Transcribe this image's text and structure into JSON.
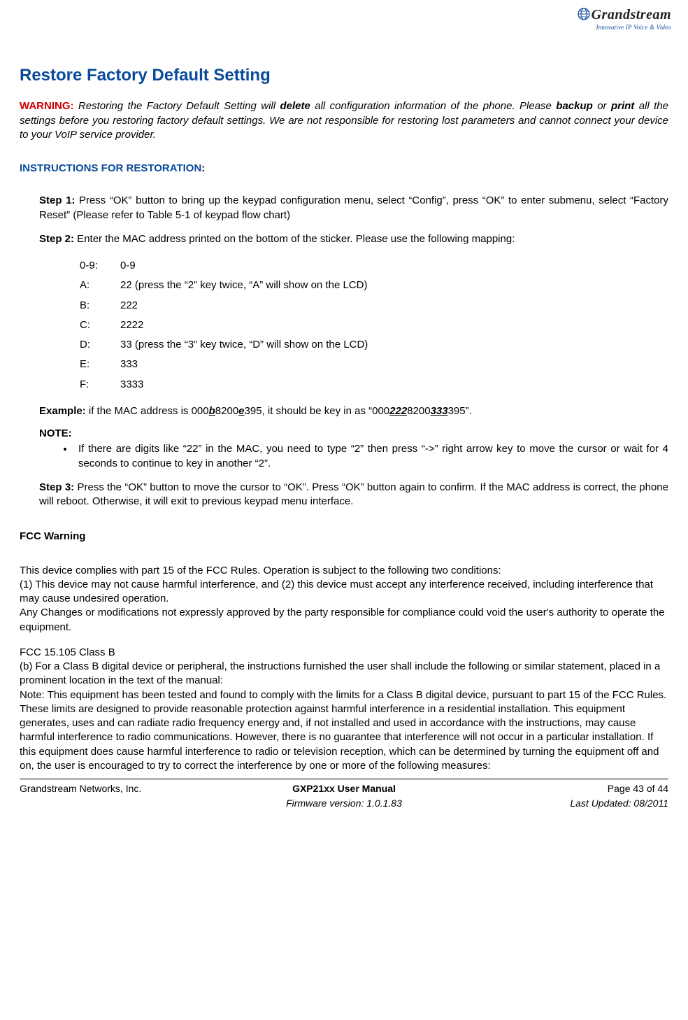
{
  "logo": {
    "brand": "Grandstream",
    "tagline": "Innovative IP Voice & Video"
  },
  "title": "Restore Factory Default Setting",
  "warning": {
    "label": "WARNING:",
    "pre": " Restoring the Factory Default Setting will ",
    "bold1": "delete",
    "mid": " all configuration information of the phone. Please ",
    "bold2": "backup",
    "mid2": " or ",
    "bold3": "print",
    "post": " all the settings before you restoring factory default settings. We are not responsible for restoring lost parameters and cannot connect your device to your VoIP service provider."
  },
  "instructions_header": "INSTRUCTIONS FOR RESTORATION",
  "step1": {
    "label": "Step 1:",
    "text": " Press “OK” button to bring up the keypad configuration menu, select “Config”, press “OK” to enter submenu, select “Factory Reset” (Please refer to Table 5-1 of keypad flow chart)"
  },
  "step2": {
    "label": "Step 2:",
    "text": " Enter the MAC address printed on the bottom of the sticker. Please use the following mapping:"
  },
  "mapping": [
    {
      "k": "0-9:",
      "v": "0-9"
    },
    {
      "k": "A:",
      "v": "22  (press the “2” key twice, “A” will show on the LCD)"
    },
    {
      "k": "B:",
      "v": "222"
    },
    {
      "k": "C:",
      "v": "2222"
    },
    {
      "k": "D:",
      "v": "33  (press the “3” key twice, “D” will show on the LCD)"
    },
    {
      "k": "E:",
      "v": "333"
    },
    {
      "k": "F:",
      "v": "3333"
    }
  ],
  "example": {
    "label": "Example:",
    "pre": "  if the MAC address is 000",
    "u1": "b",
    "mid1": "8200",
    "u2": "e",
    "mid2": "395, it should be key in as “000",
    "u3": "222",
    "mid3": "8200",
    "u4": "333",
    "post": "395”."
  },
  "note": {
    "label": "NOTE:",
    "item": "If there are digits like “22” in the MAC, you need to type “2” then press “->” right arrow key to move the cursor or wait for 4 seconds to continue to key in another “2”."
  },
  "step3": {
    "label": "Step 3:",
    "text": "  Press the “OK” button to move the cursor to “OK”. Press “OK” button again to confirm. If the MAC address is correct, the phone will reboot. Otherwise, it will exit to previous keypad menu interface."
  },
  "fcc": {
    "heading": "FCC  Warning",
    "p1": "This device complies with part 15 of the FCC Rules. Operation is subject to the following two conditions:",
    "p2": " (1) This device may not cause harmful interference, and (2) this device must accept any interference received, including  interference that may cause undesired operation.",
    "p3": "Any Changes or modifications not expressly approved by the party responsible for compliance could void the user's  authority to operate the equipment.",
    "p4": "FCC 15.105 Class B",
    "p5": "(b) For a Class B digital device or peripheral, the instructions furnished the user shall include the following or similar statement, placed in a prominent location in the text of the manual:",
    "p6": "Note: This equipment has been tested and found to comply with the limits for a Class B digital device, pursuant to part 15 of the FCC Rules. These limits are designed to provide reasonable protection against harmful interference in a residential installation. This equipment generates, uses and can radiate radio frequency energy and, if not installed and used in accordance with the instructions, may cause harmful interference to radio communications. However, there is no guarantee that interference will not occur in a particular installation. If this equipment does cause harmful interference to radio or television reception, which can be determined by turning the equipment off and on, the user is encouraged to try to correct the interference by one or more of the following measures:"
  },
  "footer": {
    "left": "Grandstream Networks, Inc.",
    "center1": "GXP21xx User Manual",
    "center2": "Firmware version: 1.0.1.83",
    "right1": "Page 43 of 44",
    "right2": "Last Updated:  08/2011"
  }
}
